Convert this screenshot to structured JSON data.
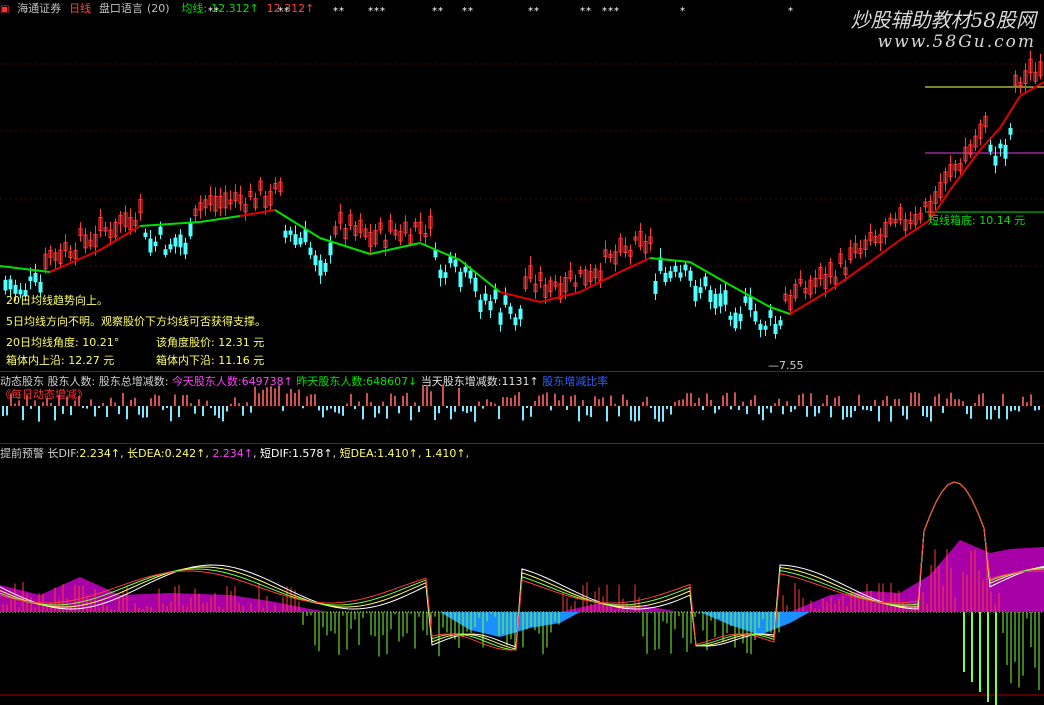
{
  "main": {
    "app_icon": "close-icon",
    "broker": "海通证券",
    "period": "日线",
    "indicator_name": "盘口语言",
    "indicator_param": "(20)",
    "ma_label": "均线:",
    "ma_value1": "12.312↑",
    "ma_value2": "12.312↑",
    "markers": [
      "**",
      "**",
      "**",
      "***",
      "**",
      "**",
      "**",
      "**",
      "***",
      "*",
      "*"
    ],
    "watermark_title": "炒股辅助教材58股网",
    "watermark_url": "www.58Gu.com",
    "box_bottom_label": "短线箱底: 10.14 元",
    "low_price_label": "—7.55",
    "notes": {
      "ma20_trend": "20日均线趋势向上。",
      "ma5_trend": "5日均线方向不明。观察股价下方均线可否获得支撑。",
      "ma20_angle_label": "20日均线角度:",
      "ma20_angle_value": "10.21°",
      "angle_price_label": "该角度股价:",
      "angle_price_value": "12.31 元",
      "box_top_label": "箱体内上沿:",
      "box_top_value": "12.27 元",
      "box_bottom_in_label": "箱体内下沿:",
      "box_bottom_in_value": "11.16 元"
    }
  },
  "holders": {
    "name": "动态股东",
    "count_label": "股东人数:",
    "total_change_label": "股东总增减数:",
    "today_label": "今天股东人数:",
    "today_value": "649738↑",
    "yesterday_label": "昨天股东人数:",
    "yesterday_value": "648607↓",
    "today_change_label": "当天股东增减数:",
    "today_change_value": "1131↑",
    "blue_label": "股东增减比率",
    "red_subtitle": "《每日动态增减》"
  },
  "macd": {
    "name": "提前预警",
    "long_dif_label": "长DIF:",
    "long_dif_value": "2.234↑",
    "long_dea_label": "长DEA:",
    "long_dea_value": "0.242↑",
    "pink_value": "2.234↑",
    "short_dif_label": "短DIF:",
    "short_dif_value": "1.578↑",
    "short_dea_label": "短DEA:",
    "short_dea_value": "1.410↑",
    "extra_value": "1.410↑"
  },
  "colors": {
    "up": "#ff3b3b",
    "down": "#54ffff",
    "ma_red": "#e00000",
    "ma_green": "#00e000",
    "text_yellow": "#ffff66",
    "macd_magenta": "#b000b0",
    "macd_blue": "#1a8fff"
  }
}
